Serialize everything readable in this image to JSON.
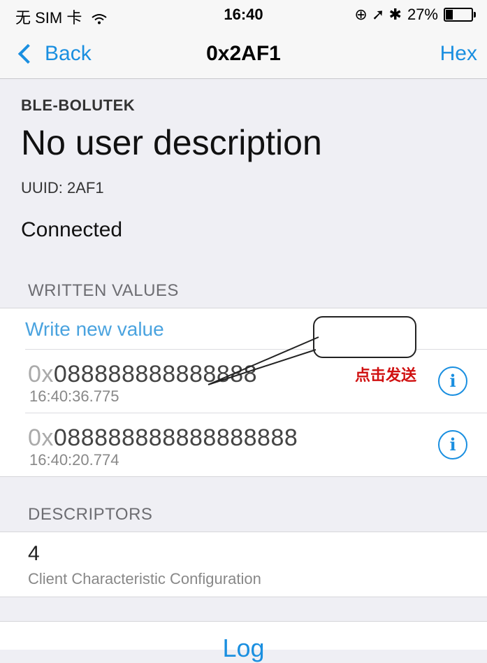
{
  "status_bar": {
    "carrier": "无 SIM 卡",
    "wifi_icon": "wifi-icon",
    "time": "16:40",
    "icons": "⊕ ➚ ✱",
    "battery": "27%",
    "battery_level": 0.27
  },
  "nav": {
    "back_label": "Back",
    "title": "0x2AF1",
    "right_label": "Hex"
  },
  "characteristic": {
    "device_name": "BLE-BOLUTEK",
    "description": "No user description",
    "uuid": "UUID: 2AF1",
    "status": "Connected"
  },
  "written_values": {
    "header": "WRITTEN VALUES",
    "write_new": "Write new value",
    "items": [
      {
        "prefix": "0x",
        "value": "088888888888888",
        "time": "16:40:36.775"
      },
      {
        "prefix": "0x",
        "value": "088888888888888888",
        "time": "16:40:20.774"
      }
    ],
    "info_glyph": "i"
  },
  "annotation": {
    "text": "点击发送"
  },
  "descriptors": {
    "header": "DESCRIPTORS",
    "items": [
      {
        "id": "4",
        "name": "Client Characteristic Configuration"
      }
    ]
  },
  "log": {
    "label": "Log"
  }
}
